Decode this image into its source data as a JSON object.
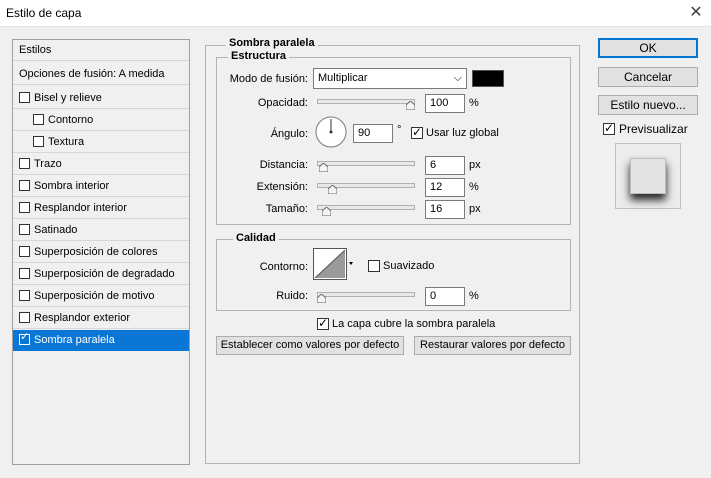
{
  "window": {
    "title": "Estilo de capa",
    "close_glyph": "✕"
  },
  "left": {
    "header": "Estilos",
    "blend_options": "Opciones de fusión: A medida",
    "items": [
      {
        "label": "Bisel y relieve",
        "checked": false,
        "indent": false
      },
      {
        "label": "Contorno",
        "checked": false,
        "indent": true
      },
      {
        "label": "Textura",
        "checked": false,
        "indent": true
      },
      {
        "label": "Trazo",
        "checked": false,
        "indent": false
      },
      {
        "label": "Sombra interior",
        "checked": false,
        "indent": false
      },
      {
        "label": "Resplandor interior",
        "checked": false,
        "indent": false
      },
      {
        "label": "Satinado",
        "checked": false,
        "indent": false
      },
      {
        "label": "Superposición de colores",
        "checked": false,
        "indent": false
      },
      {
        "label": "Superposición de degradado",
        "checked": false,
        "indent": false
      },
      {
        "label": "Superposición de motivo",
        "checked": false,
        "indent": false
      },
      {
        "label": "Resplandor exterior",
        "checked": false,
        "indent": false
      },
      {
        "label": "Sombra paralela",
        "checked": true,
        "indent": false,
        "selected": true
      }
    ]
  },
  "panel": {
    "title": "Sombra paralela",
    "structure": {
      "title": "Estructura",
      "blend_mode_label": "Modo de fusión:",
      "blend_mode_value": "Multiplicar",
      "shadow_color": "#000000",
      "opacity_label": "Opacidad:",
      "opacity_value": "100",
      "opacity_unit": "%",
      "opacity_fraction": 1.0,
      "angle_label": "Ángulo:",
      "angle_value": "90",
      "angle_unit": "°",
      "global_light_label": "Usar luz global",
      "global_light_checked": true,
      "distance_label": "Distancia:",
      "distance_value": "6",
      "distance_unit": "px",
      "distance_fraction": 0.02,
      "spread_label": "Extensión:",
      "spread_value": "12",
      "spread_unit": "%",
      "spread_fraction": 0.12,
      "size_label": "Tamaño:",
      "size_value": "16",
      "size_unit": "px",
      "size_fraction": 0.06
    },
    "quality": {
      "title": "Calidad",
      "contour_label": "Contorno:",
      "antialias_label": "Suavizado",
      "antialias_checked": false,
      "noise_label": "Ruido:",
      "noise_value": "0",
      "noise_unit": "%",
      "noise_fraction": 0.0
    },
    "knockout_label": "La capa cubre la sombra paralela",
    "knockout_checked": true,
    "make_default": "Establecer como valores por defecto",
    "reset_default": "Restaurar valores por defecto"
  },
  "buttons": {
    "ok": "OK",
    "cancel": "Cancelar",
    "new_style": "Estilo nuevo...",
    "preview_label": "Previsualizar",
    "preview_checked": true
  }
}
